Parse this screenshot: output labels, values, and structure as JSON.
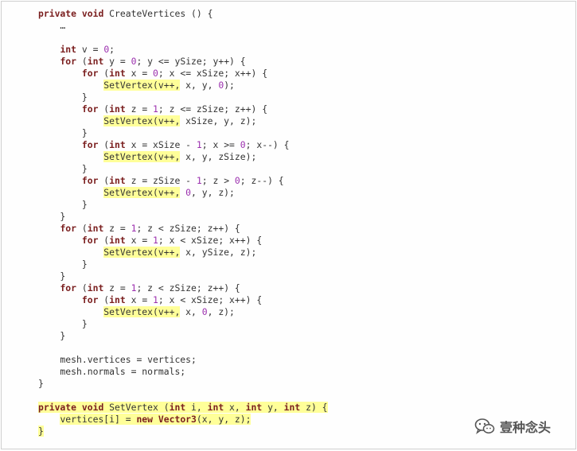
{
  "code": {
    "lines": [
      [
        {
          "t": "private",
          "c": "k"
        },
        {
          "t": " "
        },
        {
          "t": "void",
          "c": "k"
        },
        {
          "t": " CreateVertices () {"
        }
      ],
      [
        {
          "t": "    …"
        }
      ],
      [
        {
          "t": ""
        }
      ],
      [
        {
          "t": "    "
        },
        {
          "t": "int",
          "c": "k"
        },
        {
          "t": " v = "
        },
        {
          "t": "0",
          "c": "n"
        },
        {
          "t": ";"
        }
      ],
      [
        {
          "t": "    "
        },
        {
          "t": "for",
          "c": "k"
        },
        {
          "t": " ("
        },
        {
          "t": "int",
          "c": "k"
        },
        {
          "t": " y = "
        },
        {
          "t": "0",
          "c": "n"
        },
        {
          "t": "; y <= ySize; y++) {"
        }
      ],
      [
        {
          "t": "        "
        },
        {
          "t": "for",
          "c": "k"
        },
        {
          "t": " ("
        },
        {
          "t": "int",
          "c": "k"
        },
        {
          "t": " x = "
        },
        {
          "t": "0",
          "c": "n"
        },
        {
          "t": "; x <= xSize; x++) {"
        }
      ],
      [
        {
          "t": "            "
        },
        {
          "t": "SetVertex(v++,",
          "h": true
        },
        {
          "t": " x, y, "
        },
        {
          "t": "0",
          "c": "n"
        },
        {
          "t": ");"
        }
      ],
      [
        {
          "t": "        }"
        }
      ],
      [
        {
          "t": "        "
        },
        {
          "t": "for",
          "c": "k"
        },
        {
          "t": " ("
        },
        {
          "t": "int",
          "c": "k"
        },
        {
          "t": " z = "
        },
        {
          "t": "1",
          "c": "n"
        },
        {
          "t": "; z <= zSize; z++) {"
        }
      ],
      [
        {
          "t": "            "
        },
        {
          "t": "SetVertex(v++,",
          "h": true
        },
        {
          "t": " xSize, y, z);"
        }
      ],
      [
        {
          "t": "        }"
        }
      ],
      [
        {
          "t": "        "
        },
        {
          "t": "for",
          "c": "k"
        },
        {
          "t": " ("
        },
        {
          "t": "int",
          "c": "k"
        },
        {
          "t": " x = xSize - "
        },
        {
          "t": "1",
          "c": "n"
        },
        {
          "t": "; x >= "
        },
        {
          "t": "0",
          "c": "n"
        },
        {
          "t": "; x--) {"
        }
      ],
      [
        {
          "t": "            "
        },
        {
          "t": "SetVertex(v++,",
          "h": true
        },
        {
          "t": " x, y, zSize);"
        }
      ],
      [
        {
          "t": "        }"
        }
      ],
      [
        {
          "t": "        "
        },
        {
          "t": "for",
          "c": "k"
        },
        {
          "t": " ("
        },
        {
          "t": "int",
          "c": "k"
        },
        {
          "t": " z = zSize - "
        },
        {
          "t": "1",
          "c": "n"
        },
        {
          "t": "; z > "
        },
        {
          "t": "0",
          "c": "n"
        },
        {
          "t": "; z--) {"
        }
      ],
      [
        {
          "t": "            "
        },
        {
          "t": "SetVertex(v++,",
          "h": true
        },
        {
          "t": " "
        },
        {
          "t": "0",
          "c": "n"
        },
        {
          "t": ", y, z);"
        }
      ],
      [
        {
          "t": "        }"
        }
      ],
      [
        {
          "t": "    }"
        }
      ],
      [
        {
          "t": "    "
        },
        {
          "t": "for",
          "c": "k"
        },
        {
          "t": " ("
        },
        {
          "t": "int",
          "c": "k"
        },
        {
          "t": " z = "
        },
        {
          "t": "1",
          "c": "n"
        },
        {
          "t": "; z < zSize; z++) {"
        }
      ],
      [
        {
          "t": "        "
        },
        {
          "t": "for",
          "c": "k"
        },
        {
          "t": " ("
        },
        {
          "t": "int",
          "c": "k"
        },
        {
          "t": " x = "
        },
        {
          "t": "1",
          "c": "n"
        },
        {
          "t": "; x < xSize; x++) {"
        }
      ],
      [
        {
          "t": "            "
        },
        {
          "t": "SetVertex(v++,",
          "h": true
        },
        {
          "t": " x, ySize, z);"
        }
      ],
      [
        {
          "t": "        }"
        }
      ],
      [
        {
          "t": "    }"
        }
      ],
      [
        {
          "t": "    "
        },
        {
          "t": "for",
          "c": "k"
        },
        {
          "t": " ("
        },
        {
          "t": "int",
          "c": "k"
        },
        {
          "t": " z = "
        },
        {
          "t": "1",
          "c": "n"
        },
        {
          "t": "; z < zSize; z++) {"
        }
      ],
      [
        {
          "t": "        "
        },
        {
          "t": "for",
          "c": "k"
        },
        {
          "t": " ("
        },
        {
          "t": "int",
          "c": "k"
        },
        {
          "t": " x = "
        },
        {
          "t": "1",
          "c": "n"
        },
        {
          "t": "; x < xSize; x++) {"
        }
      ],
      [
        {
          "t": "            "
        },
        {
          "t": "SetVertex(v++,",
          "h": true
        },
        {
          "t": " x, "
        },
        {
          "t": "0",
          "c": "n"
        },
        {
          "t": ", z);"
        }
      ],
      [
        {
          "t": "        }"
        }
      ],
      [
        {
          "t": "    }"
        }
      ],
      [
        {
          "t": ""
        }
      ],
      [
        {
          "t": "    mesh.vertices = vertices;"
        }
      ],
      [
        {
          "t": "    mesh.normals = normals;"
        }
      ],
      [
        {
          "t": "}"
        }
      ],
      [
        {
          "t": ""
        }
      ],
      [
        {
          "t": "private",
          "c": "k",
          "h": true
        },
        {
          "t": " ",
          "h": true
        },
        {
          "t": "void",
          "c": "k",
          "h": true
        },
        {
          "t": " SetVertex (",
          "h": true
        },
        {
          "t": "int",
          "c": "k",
          "h": true
        },
        {
          "t": " i, ",
          "h": true
        },
        {
          "t": "int",
          "c": "k",
          "h": true
        },
        {
          "t": " x, ",
          "h": true
        },
        {
          "t": "int",
          "c": "k",
          "h": true
        },
        {
          "t": " y, ",
          "h": true
        },
        {
          "t": "int",
          "c": "k",
          "h": true
        },
        {
          "t": " z) {",
          "h": true
        }
      ],
      [
        {
          "t": "    "
        },
        {
          "t": "vertices[i] = ",
          "h": true
        },
        {
          "t": "new",
          "c": "k",
          "h": true
        },
        {
          "t": " ",
          "h": true
        },
        {
          "t": "Vector3",
          "c": "k",
          "h": true
        },
        {
          "t": "(x, y, z);",
          "h": true
        }
      ],
      [
        {
          "t": "}",
          "h": true
        }
      ]
    ]
  },
  "watermark": {
    "icon": "wechat-icon",
    "text": "壹种念头"
  },
  "colors": {
    "keyword": "#7a1e1e",
    "number": "#9b2fae",
    "highlight": "#ffff99",
    "text": "#333333"
  }
}
